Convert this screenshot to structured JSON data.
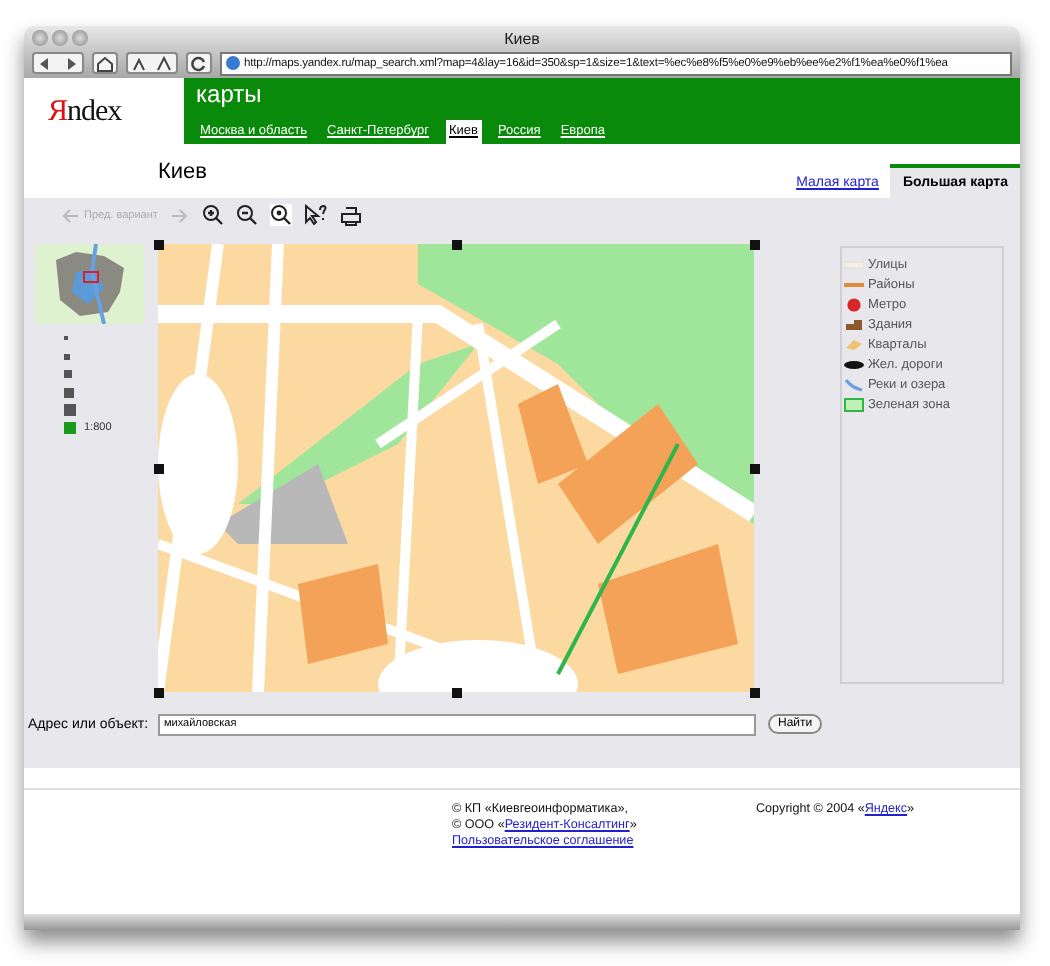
{
  "window": {
    "title": "Киев",
    "url": "http://maps.yandex.ru/map_search.xml?map=4&lay=16&id=350&sp=1&size=1&text=%ec%e8%f5%e0%e9%eb%ee%e2%f1%ea%e0%f1%ea"
  },
  "logo": {
    "first": "Я",
    "rest": "ndex"
  },
  "service_title": "карты",
  "region_tabs": [
    {
      "label": "Москва и область",
      "selected": false
    },
    {
      "label": "Санкт-Петербург",
      "selected": false
    },
    {
      "label": "Киев",
      "selected": true
    },
    {
      "label": "Россия",
      "selected": false
    },
    {
      "label": "Европа",
      "selected": false
    }
  ],
  "heading": "Киев",
  "size_tabs": [
    {
      "label": "Малая карта",
      "selected": false
    },
    {
      "label": "Большая карта",
      "selected": true
    }
  ],
  "map_toolbar": {
    "previous": {
      "label": "Пред. вариант",
      "disabled": true
    }
  },
  "scale": [
    {
      "selected": false
    },
    {
      "selected": false
    },
    {
      "selected": false
    },
    {
      "selected": false
    },
    {
      "selected": false
    },
    {
      "selected": true,
      "label": "1:800"
    }
  ],
  "legend": [
    {
      "kind": "street",
      "label": "Улицы"
    },
    {
      "kind": "district",
      "label": "Районы"
    },
    {
      "kind": "metro",
      "label": "Метро"
    },
    {
      "kind": "building",
      "label": "Здания"
    },
    {
      "kind": "block",
      "label": "Кварталы"
    },
    {
      "kind": "railway",
      "label": "Жел. дороги"
    },
    {
      "kind": "river",
      "label": "Реки и озера"
    },
    {
      "kind": "park",
      "label": "Зеленая зона"
    }
  ],
  "search": {
    "label": "Адрес или объект:",
    "value": "михайловская",
    "button": "Найти"
  },
  "footer": {
    "line1": "© КП «Киевгеоинформатика»,",
    "line2_before": "© ООО «",
    "line2_link": "Резидент-Консалтинг",
    "line2_after": "»",
    "agreement_link": "Пользовательское соглашение",
    "copyright_before": "Copyright © 2004 «",
    "copyright_link": "Яндекс",
    "copyright_after": "»"
  }
}
